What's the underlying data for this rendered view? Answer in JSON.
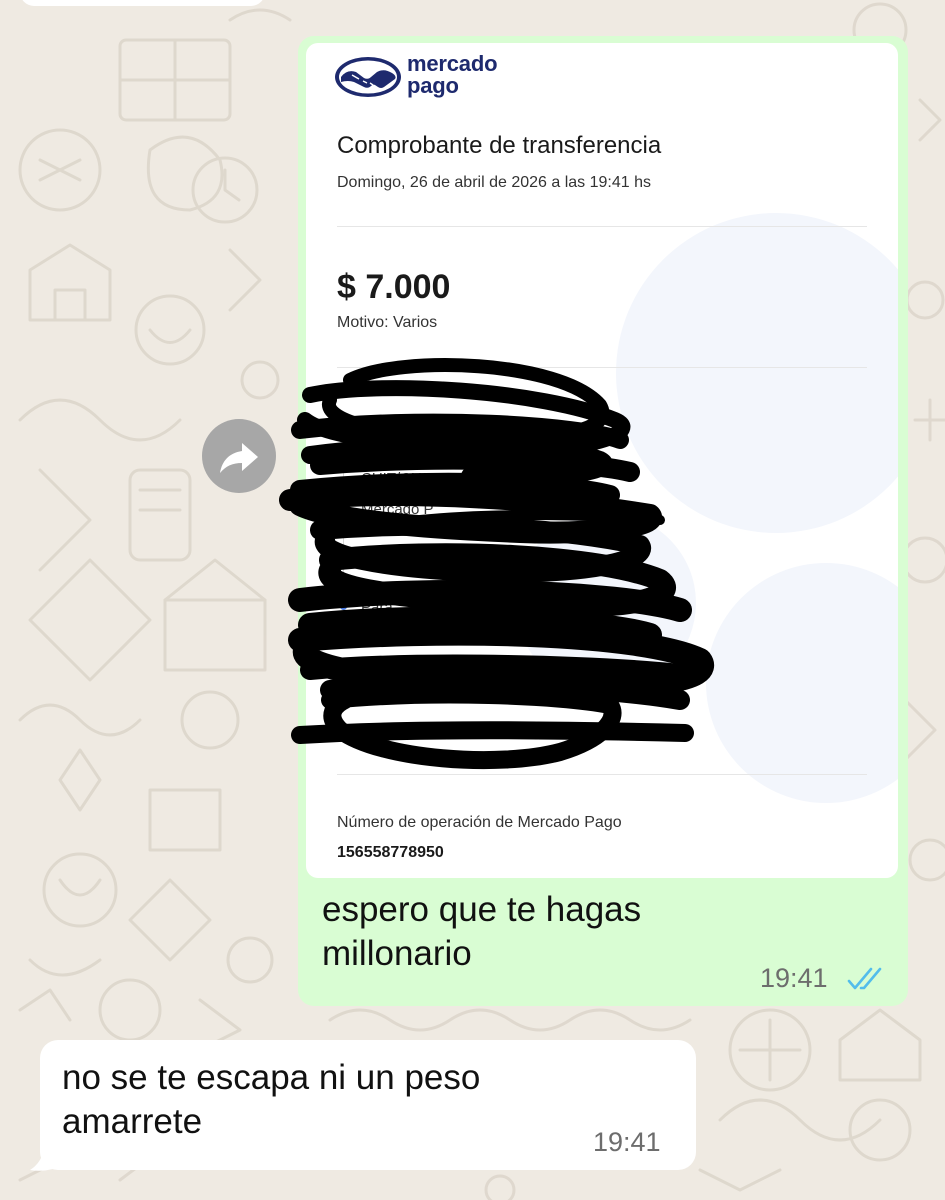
{
  "receipt": {
    "brand_line1": "mercado",
    "brand_line2": "pago",
    "title": "Comprobante de transferencia",
    "date": "Domingo, 26 de abril de 2026 a las 19:41 hs",
    "amount": "$ 7.000",
    "reason": "Motivo: Varios",
    "from_partial_1": "CUIT/CU",
    "from_partial_2": "Mercado P",
    "from_partial_3": "3",
    "to_partial": "Para",
    "operation_label": "Número de operación de Mercado Pago",
    "operation_number": "156558778950"
  },
  "outgoing_message": {
    "line1": "espero que te hagas",
    "line2": "millonario",
    "time": "19:41",
    "status_icon": "double-check-read-icon",
    "status_color": "#53bdeb"
  },
  "incoming_message": {
    "line1": "no se te escapa ni un peso",
    "line2": "amarrete",
    "time": "19:41"
  },
  "colors": {
    "chat_background": "#efeae2",
    "outgoing_bubble": "#d9fdd3",
    "incoming_bubble": "#ffffff",
    "brand_blue": "#1e2a6e",
    "scribble": "#000000"
  },
  "icons": {
    "forward": "forward-arrow-icon",
    "logo": "mercado-pago-handshake-logo"
  }
}
